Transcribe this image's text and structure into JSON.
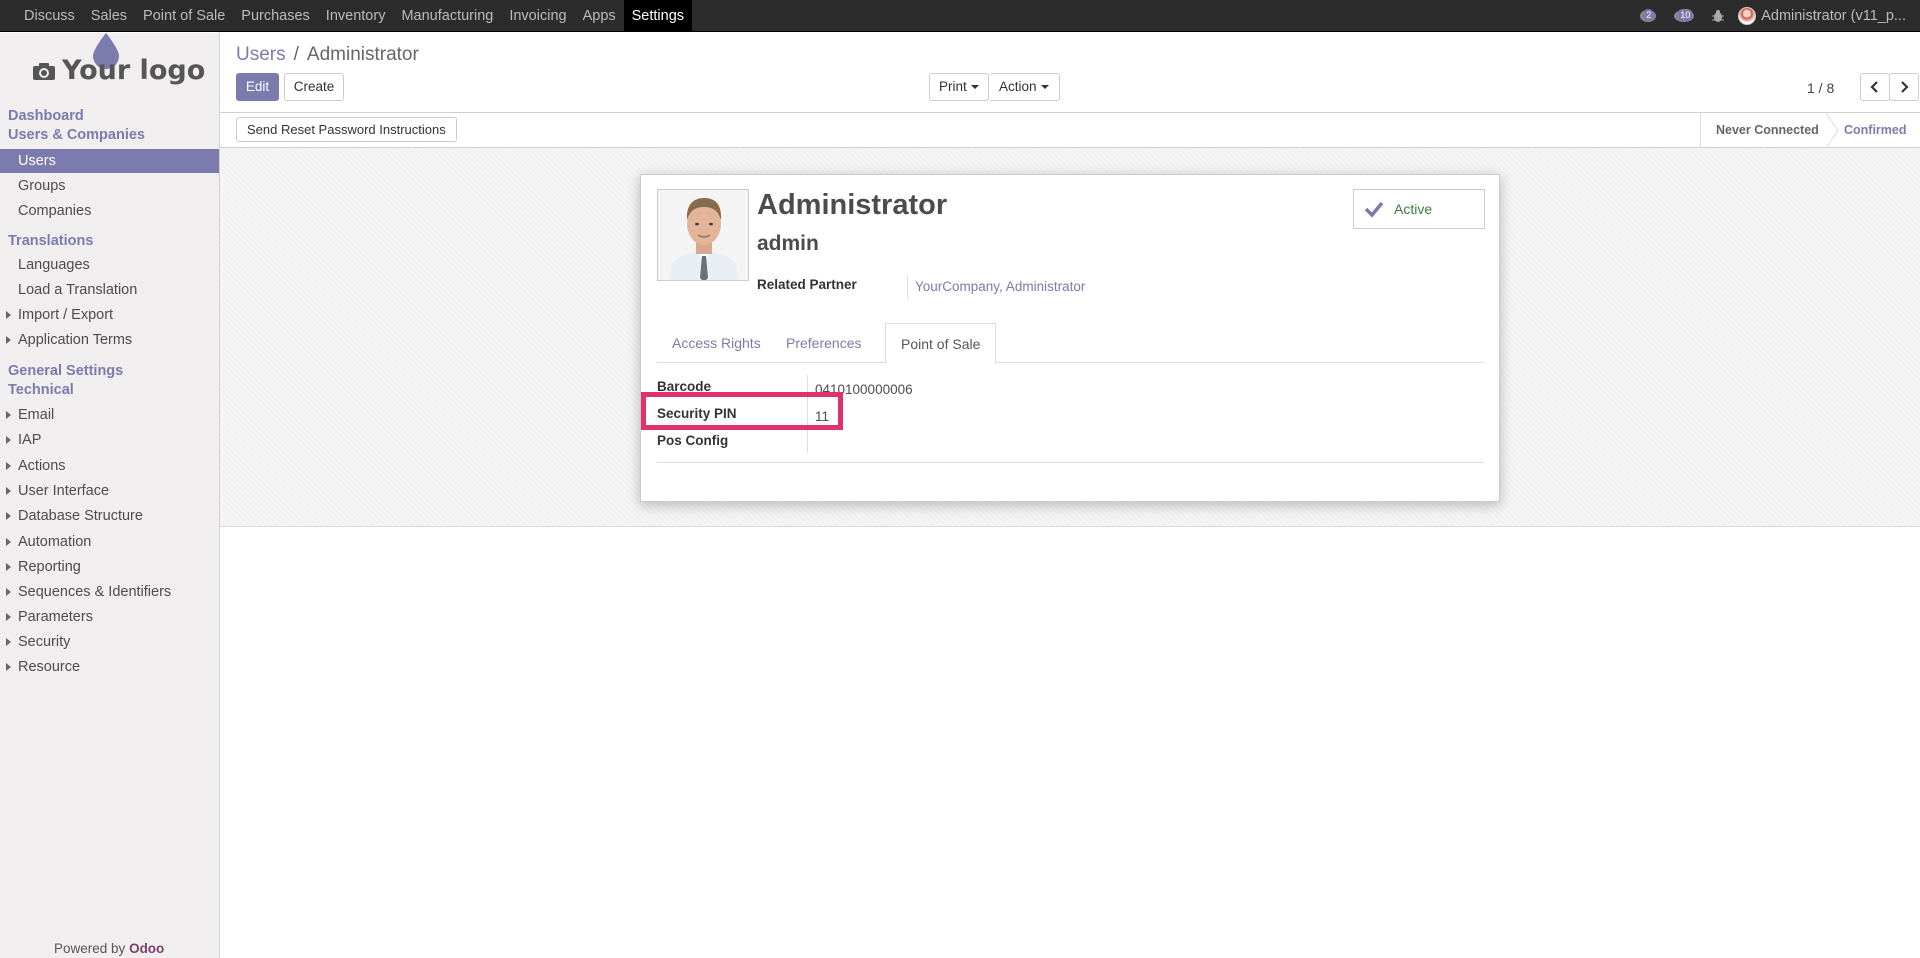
{
  "topnav": {
    "items": [
      "Discuss",
      "Sales",
      "Point of Sale",
      "Purchases",
      "Inventory",
      "Manufacturing",
      "Invoicing",
      "Apps",
      "Settings"
    ],
    "active": "Settings",
    "chat_count": "2",
    "activity_count": "10",
    "user": "Administrator (v11_p..."
  },
  "sidebar": {
    "logo_text": "Your logo",
    "dashboard": "Dashboard",
    "users_companies": "Users & Companies",
    "users": "Users",
    "groups": "Groups",
    "companies": "Companies",
    "translations": "Translations",
    "languages": "Languages",
    "load_translation": "Load a Translation",
    "import_export": "Import / Export",
    "application_terms": "Application Terms",
    "general_settings": "General Settings",
    "technical": "Technical",
    "email": "Email",
    "iap": "IAP",
    "actions": "Actions",
    "user_interface": "User Interface",
    "database_structure": "Database Structure",
    "automation": "Automation",
    "reporting": "Reporting",
    "sequences": "Sequences & Identifiers",
    "parameters": "Parameters",
    "security": "Security",
    "resource": "Resource",
    "powered_by": "Powered by",
    "odoo": "Odoo"
  },
  "control": {
    "breadcrumb_parent": "Users",
    "breadcrumb_sep": "/",
    "breadcrumb_current": "Administrator",
    "edit": "Edit",
    "create": "Create",
    "print": "Print",
    "action": "Action",
    "pager": "1 / 8"
  },
  "statusbar": {
    "reset_password": "Send Reset Password Instructions",
    "stage_never": "Never Connected",
    "stage_confirmed": "Confirmed"
  },
  "form": {
    "name": "Administrator",
    "login": "admin",
    "related_partner_label": "Related Partner",
    "related_partner_value": "YourCompany, Administrator",
    "active_label": "Active",
    "tabs": [
      "Access Rights",
      "Preferences",
      "Point of Sale"
    ],
    "active_tab": "Point of Sale",
    "barcode_label": "Barcode",
    "barcode_value": "0410100000006",
    "pin_label": "Security PIN",
    "pin_value": "11",
    "pos_config_label": "Pos Config"
  },
  "colors": {
    "accent": "#7c7bad",
    "highlight": "#e0316b"
  }
}
